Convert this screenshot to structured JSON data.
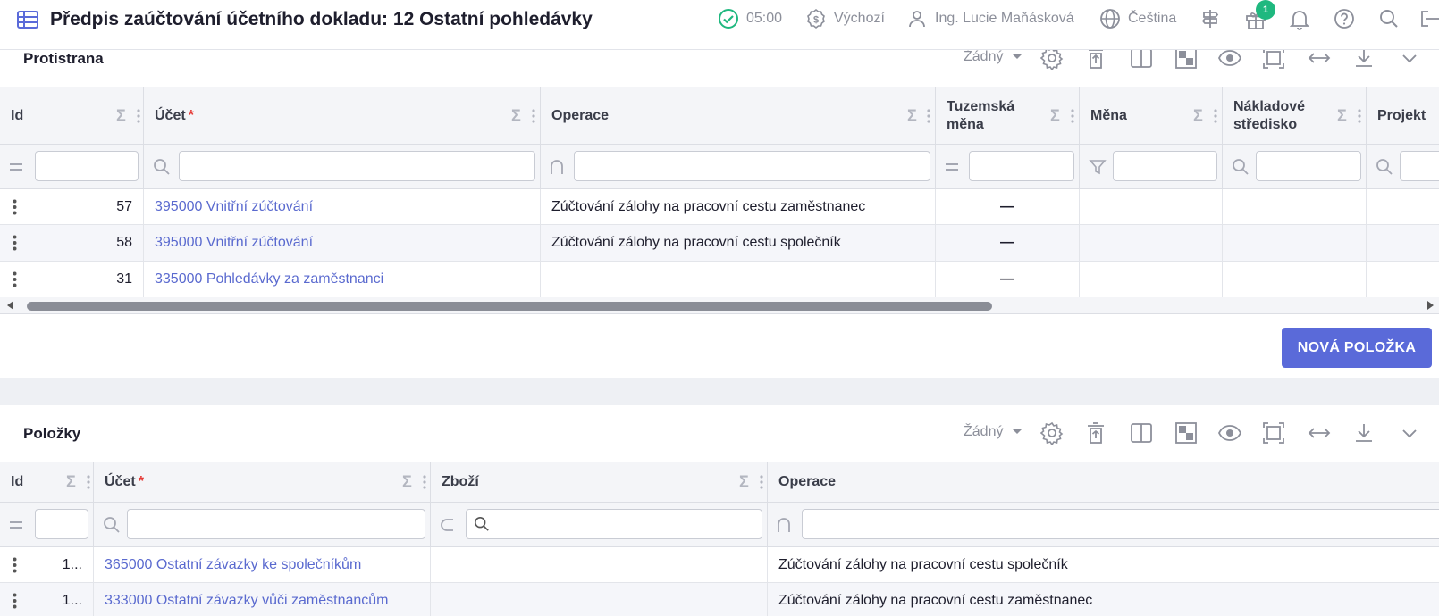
{
  "header": {
    "title": "Předpis zaúčtování účetního dokladu: 12 Ostatní pohledávky",
    "timer": "05:00",
    "currency": "Výchozí",
    "user": "Ing. Lucie Maňásková",
    "language": "Čeština",
    "gift_badge": "1"
  },
  "panel1": {
    "title": "Protistrana",
    "view_select": "Žádný",
    "columns": {
      "id": "Id",
      "account": "Účet",
      "operation": "Operace",
      "local_currency_l1": "Tuzemská",
      "local_currency_l2": "měna",
      "currency": "Měna",
      "cost_center_l1": "Nákladové",
      "cost_center_l2": "středisko",
      "project": "Projekt"
    },
    "required_mark": "*",
    "rows": [
      {
        "id": "57",
        "account": "395000 Vnitřní zúčtování",
        "operation": "Zúčtování zálohy na pracovní cestu zaměstnanec",
        "local": "—"
      },
      {
        "id": "58",
        "account": "395000 Vnitřní zúčtování",
        "operation": "Zúčtování zálohy na pracovní cestu společník",
        "local": "—"
      },
      {
        "id": "31",
        "account": "335000 Pohledávky za zaměstnanci",
        "operation": "",
        "local": "—"
      }
    ],
    "new_button": "NOVÁ POLOŽKA"
  },
  "panel2": {
    "title": "Položky",
    "view_select": "Žádný",
    "columns": {
      "id": "Id",
      "account": "Účet",
      "goods": "Zboží",
      "operation": "Operace"
    },
    "rows": [
      {
        "id": "1...",
        "account": "365000 Ostatní závazky ke společníkům",
        "goods": "",
        "operation": "Zúčtování zálohy na pracovní cestu společník"
      },
      {
        "id": "1...",
        "account": "333000 Ostatní závazky vůči zaměstnancům",
        "goods": "",
        "operation": "Zúčtování zálohy na pracovní cestu zaměstnanec"
      }
    ]
  },
  "colors": {
    "accent": "#5a6ad9",
    "link": "#5a6acf",
    "success": "#1fb87f",
    "required": "#e53935"
  }
}
